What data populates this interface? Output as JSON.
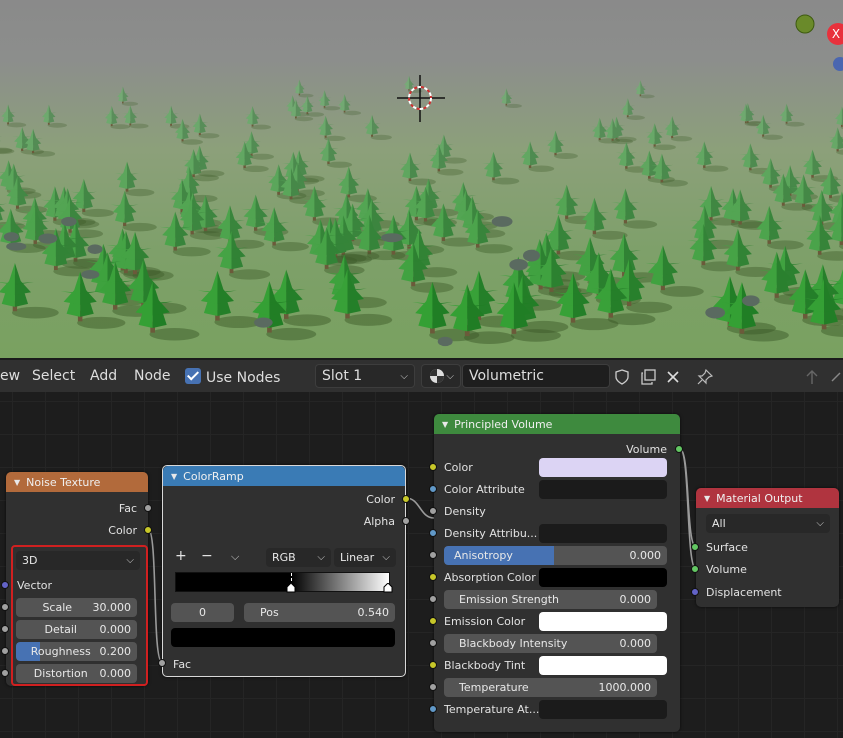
{
  "header": {
    "menus": [
      "ew",
      "Select",
      "Add",
      "Node"
    ],
    "use_nodes_label": "Use Nodes",
    "slot": "Slot 1",
    "material_name": "Volumetric"
  },
  "noise_texture": {
    "title": "Noise Texture",
    "output_fac": "Fac",
    "output_color": "Color",
    "dimension": "3D",
    "input_vector": "Vector",
    "scale_label": "Scale",
    "scale_value": "30.000",
    "detail_label": "Detail",
    "detail_value": "0.000",
    "roughness_label": "Roughness",
    "roughness_value": "0.200",
    "distortion_label": "Distortion",
    "distortion_value": "0.000"
  },
  "color_ramp": {
    "title": "ColorRamp",
    "output_color": "Color",
    "output_alpha": "Alpha",
    "add": "+",
    "remove": "−",
    "color_mode": "RGB",
    "interpolation": "Linear",
    "index": "0",
    "pos_label": "Pos",
    "pos_value": "0.540",
    "input_fac": "Fac"
  },
  "principled_volume": {
    "title": "Principled Volume",
    "output_volume": "Volume",
    "color": "Color",
    "color_attribute": "Color Attribute",
    "density": "Density",
    "density_attribute": "Density Attribu...",
    "anisotropy_label": "Anisotropy",
    "anisotropy_value": "0.000",
    "absorption_color": "Absorption Color",
    "emission_strength_label": "Emission Strength",
    "emission_strength_value": "0.000",
    "emission_color": "Emission Color",
    "blackbody_intensity_label": "Blackbody Intensity",
    "blackbody_intensity_value": "0.000",
    "blackbody_tint": "Blackbody Tint",
    "temperature_label": "Temperature",
    "temperature_value": "1000.000",
    "temperature_attribute": "Temperature At..."
  },
  "material_output": {
    "title": "Material Output",
    "target": "All",
    "surface": "Surface",
    "volume": "Volume",
    "displacement": "Displacement"
  },
  "viewport": {
    "close_glyph": "X"
  },
  "colors": {
    "noise_header": "#b26a3b",
    "colorramp_header": "#3a7bb5",
    "principled_header": "#3e8a3e",
    "output_header": "#b0343f",
    "highlight_box": "#d02020",
    "principled_color": "#dcd4f4"
  },
  "icons": [
    "check-icon",
    "sphere-icon",
    "shield-icon",
    "duplicate-icon",
    "close-icon",
    "pin-icon",
    "arrow-up-icon",
    "chevron-down-icon",
    "cursor-icon"
  ]
}
